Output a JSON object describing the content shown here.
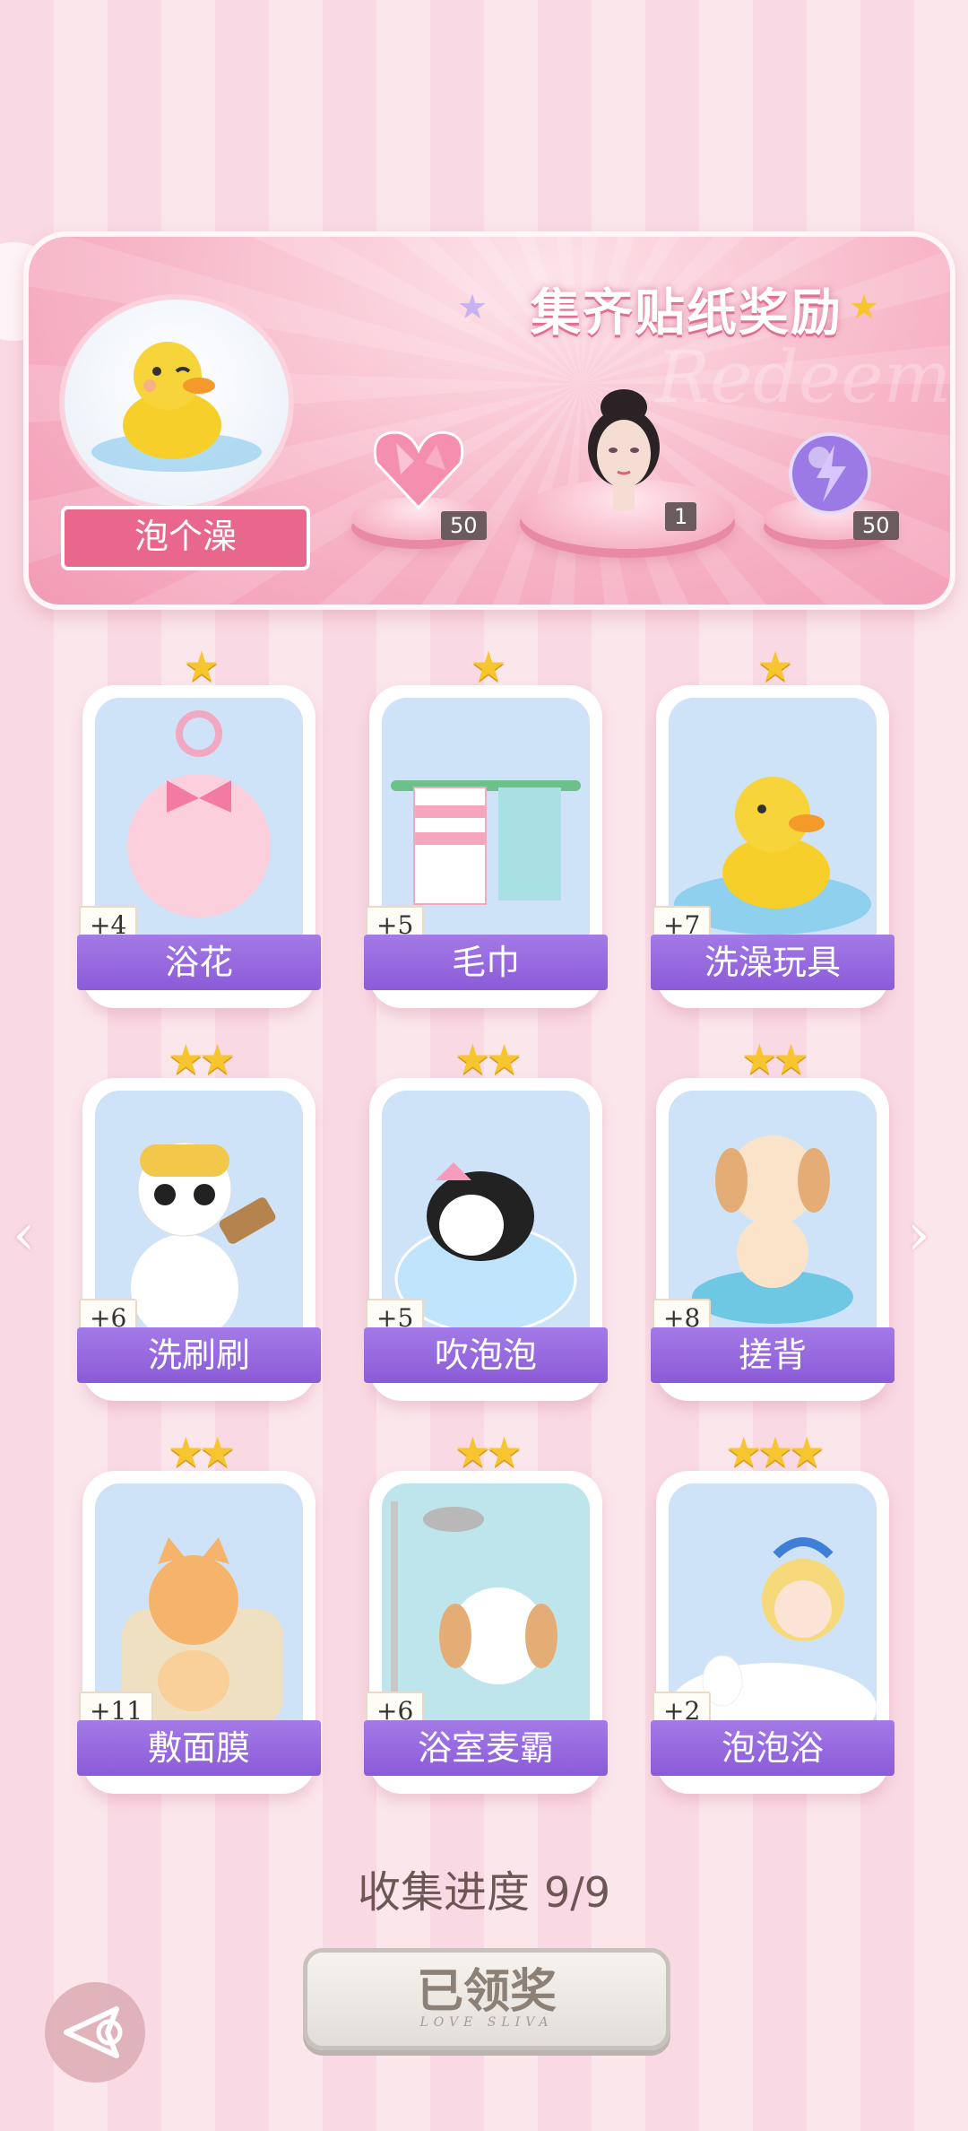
{
  "banner": {
    "title": "集齐贴纸奖励",
    "watermark": "Redeem",
    "theme_label": "泡个澡",
    "rewards": [
      {
        "icon": "heart-gem-icon",
        "count": "50"
      },
      {
        "icon": "avatar-portrait-icon",
        "count": "1"
      },
      {
        "icon": "lightning-orb-icon",
        "count": "50"
      }
    ]
  },
  "cards": [
    {
      "label": "浴花",
      "bonus": "+4",
      "stars": "★",
      "icon": "bath-pouf-icon"
    },
    {
      "label": "毛巾",
      "bonus": "+5",
      "stars": "★",
      "icon": "towel-icon"
    },
    {
      "label": "洗澡玩具",
      "bonus": "+7",
      "stars": "★",
      "icon": "rubber-duck-icon"
    },
    {
      "label": "洗刷刷",
      "bonus": "+6",
      "stars": "★★",
      "icon": "panda-brush-icon"
    },
    {
      "label": "吹泡泡",
      "bonus": "+5",
      "stars": "★★",
      "icon": "penguin-bubble-icon"
    },
    {
      "label": "搓背",
      "bonus": "+8",
      "stars": "★★",
      "icon": "puppy-tub-icon"
    },
    {
      "label": "敷面膜",
      "bonus": "+11",
      "stars": "★★",
      "icon": "cat-mask-icon"
    },
    {
      "label": "浴室麦霸",
      "bonus": "+6",
      "stars": "★★",
      "icon": "puppy-shower-icon"
    },
    {
      "label": "泡泡浴",
      "bonus": "+2",
      "stars": "★★★",
      "icon": "girl-bubble-bath-icon"
    }
  ],
  "progress": {
    "label": "收集进度",
    "value": "9/9"
  },
  "claim_button": {
    "label": "已领奖",
    "sublabel": "LOVE SLIVA"
  },
  "nav": {
    "left": "‹",
    "right": "›"
  }
}
